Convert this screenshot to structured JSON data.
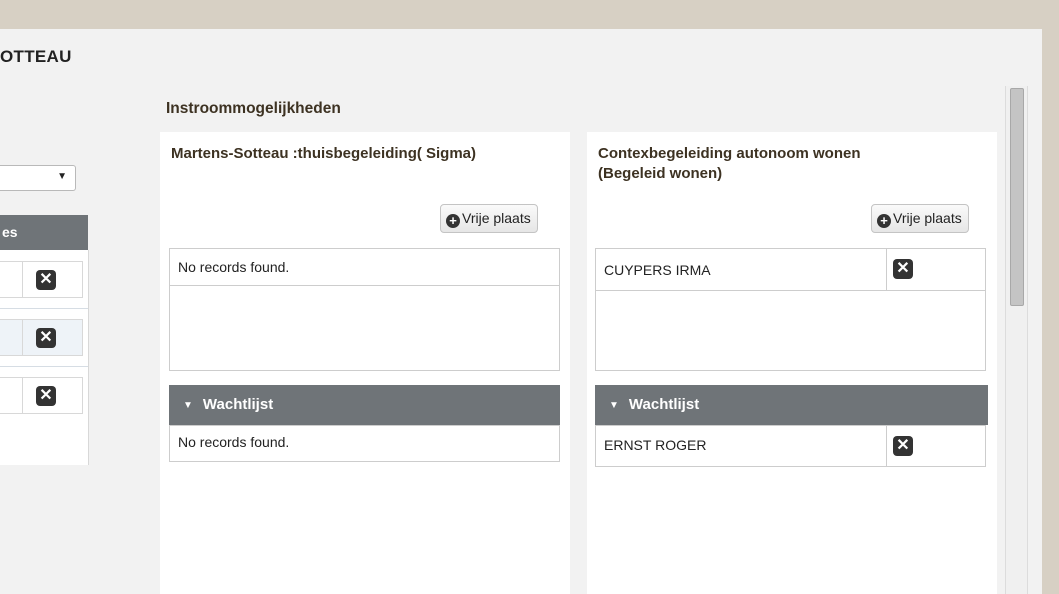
{
  "page": {
    "title": "OTTEAU",
    "section_title": "Instroommogelijkheden"
  },
  "left_panel": {
    "select_value": "",
    "header": "es",
    "rows": [
      {
        "action": "delete"
      },
      {
        "action": "delete"
      },
      {
        "action": "delete"
      }
    ]
  },
  "icons": {
    "delete": "close-icon",
    "add": "plus-circle-icon",
    "caret": "caret-down-icon"
  },
  "cards": [
    {
      "title": "Martens-Sotteau :thuisbegeleiding( Sigma)",
      "button_label": "Vrije plaats",
      "table_rows": [
        "No records found."
      ],
      "waitlist_header": "Wachtlijst",
      "waitlist_rows": [
        "No records found."
      ]
    },
    {
      "title": "Contexbegeleiding autonoom wonen (Begeleid wonen)",
      "button_label": "Vrije plaats",
      "table_rows": [
        "CUYPERS IRMA"
      ],
      "waitlist_header": "Wachtlijst",
      "waitlist_rows": [
        "ERNST ROGER"
      ]
    }
  ],
  "colors": {
    "header_bg": "#6f7478",
    "title_brown": "#3d3222",
    "frame": "#d7d0c4"
  }
}
